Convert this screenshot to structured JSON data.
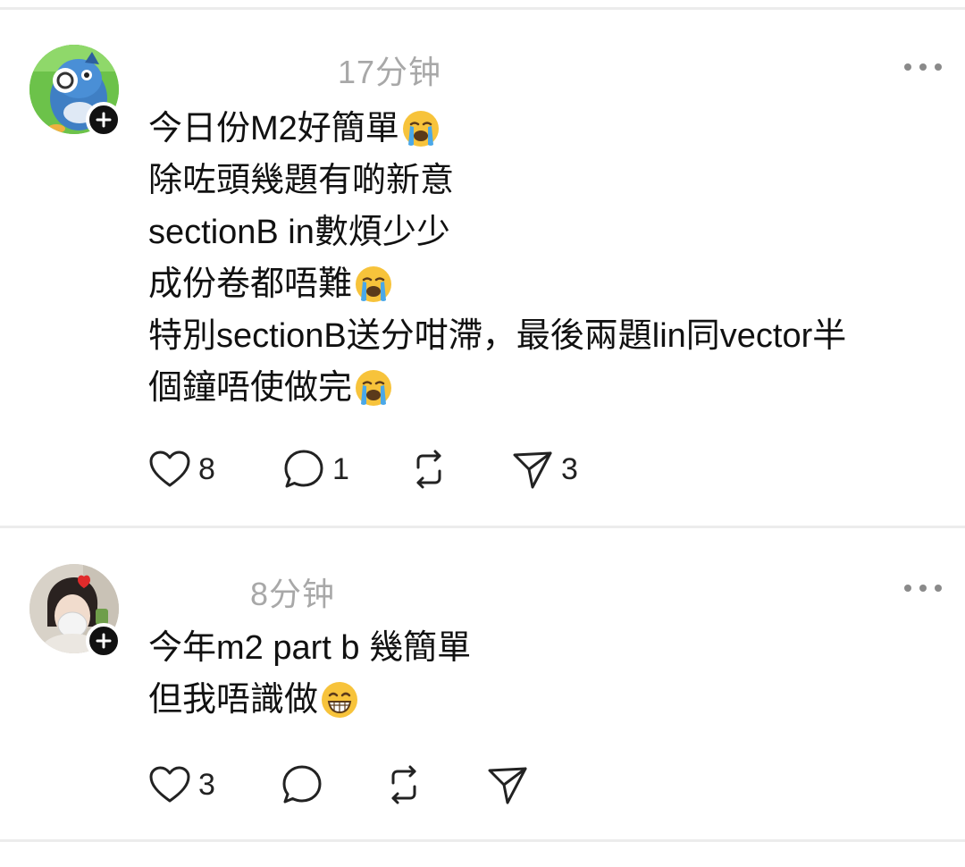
{
  "posts": [
    {
      "timestamp": "17分钟",
      "lines": [
        "今日份M2好簡單",
        "除咗頭幾題有啲新意",
        "sectionB in數煩少少",
        "成份卷都唔難",
        "特別sectionB送分咁滯，最後兩題lin同vector半",
        "個鐘唔使做完"
      ],
      "line_emojis": [
        "crying-face",
        "",
        "",
        "crying-face",
        "",
        "crying-face"
      ],
      "likes": "8",
      "comments": "1",
      "reposts": "",
      "shares": "3"
    },
    {
      "timestamp": "8分钟",
      "lines": [
        "今年m2 part b 幾簡單",
        "但我唔識做"
      ],
      "line_emojis": [
        "",
        "grinning-face"
      ],
      "likes": "3",
      "comments": "",
      "reposts": "",
      "shares": ""
    }
  ],
  "icons": {
    "like": "heart-icon",
    "comment": "comment-bubble-icon",
    "repost": "repost-icon",
    "share": "send-icon",
    "more": "more-options-icon",
    "follow": "plus-icon"
  },
  "colors": {
    "text": "#111111",
    "timestamp": "#a8a8a8",
    "divider": "#ececec",
    "badge": "#111111"
  }
}
